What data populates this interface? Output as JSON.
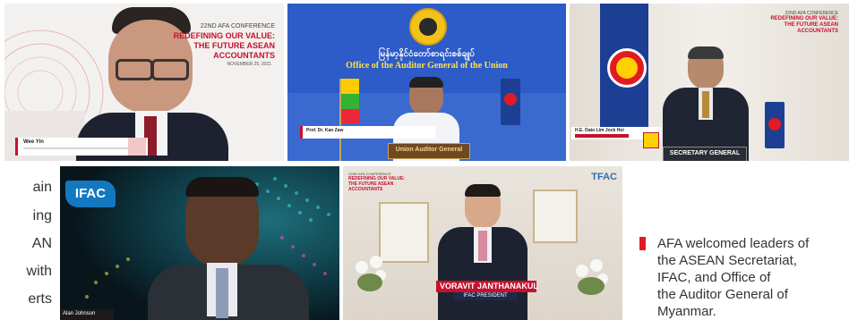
{
  "tiles": {
    "t1": {
      "conference": "22ND AFA CONFERENCE",
      "theme_line1": "REDEFINING OUR VALUE:",
      "theme_line2": "THE FUTURE ASEAN",
      "theme_line3": "ACCOUNTANTS",
      "date": "NOVEMBER 25, 2021",
      "name": "Wee Yin"
    },
    "t2": {
      "myanmar_title": "မြန်မာ့နိုင်ငံတော်စာရင်းစစ်ချုပ်",
      "office_title": "Office of the Auditor General of the Union",
      "name": "Prof. Dr. Kan Zaw",
      "placard": "Union Auditor General"
    },
    "t3": {
      "conference": "22ND AFA CONFERENCE",
      "theme_line1": "REDEFINING OUR VALUE:",
      "theme_line2": "THE FUTURE ASEAN",
      "theme_line3": "ACCOUNTANTS",
      "name": "H.E. Dato Lim Jock Hoi",
      "placard": "SECRETARY GENERAL"
    },
    "t4": {
      "logo": "IFAC",
      "name": "Alan Johnson"
    },
    "t5": {
      "conference": "22ND AFA CONFERENCE",
      "theme_line1": "REDEFINING OUR VALUE:",
      "theme_line2": "THE FUTURE ASEAN",
      "theme_line3": "ACCOUNTANTS",
      "logo": "TFAC",
      "name": "VORAVIT JANTHANAKUL",
      "role": "IFAC PRESIDENT"
    }
  },
  "left_fragments": [
    "ain",
    "ing",
    "AN",
    "with",
    "erts"
  ],
  "caption": {
    "line1": "AFA welcomed leaders of",
    "line2": "the ASEAN Secretariat,",
    "line3": "IFAC, and Office of",
    "line4": "the Auditor General of",
    "line5": "Myanmar."
  },
  "colors": {
    "accent_red": "#e21b23",
    "afa_red": "#c8102e",
    "myanmar_blue": "#2d5bc7",
    "ifac_blue": "#1279c1",
    "asean_blue": "#1c3f94"
  }
}
